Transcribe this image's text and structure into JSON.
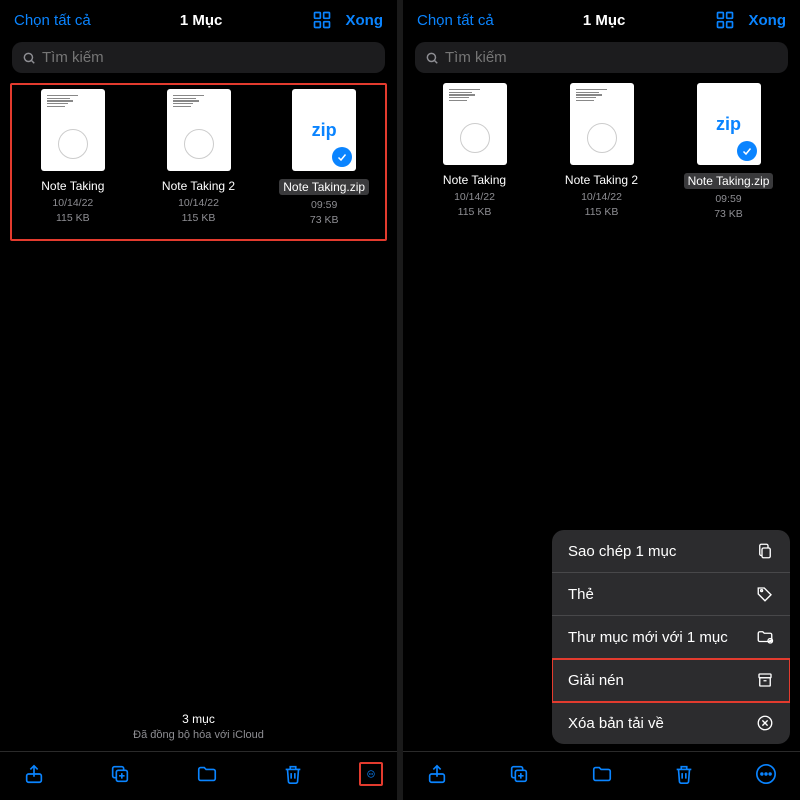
{
  "left": {
    "header": {
      "select_all": "Chọn tất cả",
      "title": "1 Mục",
      "done": "Xong"
    },
    "search": {
      "placeholder": "Tìm kiếm"
    },
    "files": [
      {
        "name": "Note Taking",
        "date": "10/14/22",
        "size": "115 KB",
        "selected": false,
        "zip": false
      },
      {
        "name": "Note Taking 2",
        "date": "10/14/22",
        "size": "115 KB",
        "selected": false,
        "zip": false
      },
      {
        "name": "Note Taking.zip",
        "date": "09:59",
        "size": "73 KB",
        "selected": true,
        "zip": true
      }
    ],
    "status": {
      "count": "3 mục",
      "sync": "Đã đồng bộ hóa với iCloud"
    }
  },
  "right": {
    "header": {
      "select_all": "Chọn tất cả",
      "title": "1 Mục",
      "done": "Xong"
    },
    "search": {
      "placeholder": "Tìm kiếm"
    },
    "files": [
      {
        "name": "Note Taking",
        "date": "10/14/22",
        "size": "115 KB",
        "selected": false,
        "zip": false
      },
      {
        "name": "Note Taking 2",
        "date": "10/14/22",
        "size": "115 KB",
        "selected": false,
        "zip": false
      },
      {
        "name": "Note Taking.zip",
        "date": "09:59",
        "size": "73 KB",
        "selected": true,
        "zip": true
      }
    ],
    "menu": [
      {
        "label": "Sao chép 1 mục",
        "icon": "copy-icon"
      },
      {
        "label": "Thẻ",
        "icon": "tag-icon"
      },
      {
        "label": "Thư mục mới với 1 mục",
        "icon": "new-folder-icon"
      },
      {
        "label": "Giải nén",
        "icon": "archive-icon"
      },
      {
        "label": "Xóa bản tải về",
        "icon": "remove-download-icon"
      }
    ]
  },
  "zip_glyph": "zip"
}
